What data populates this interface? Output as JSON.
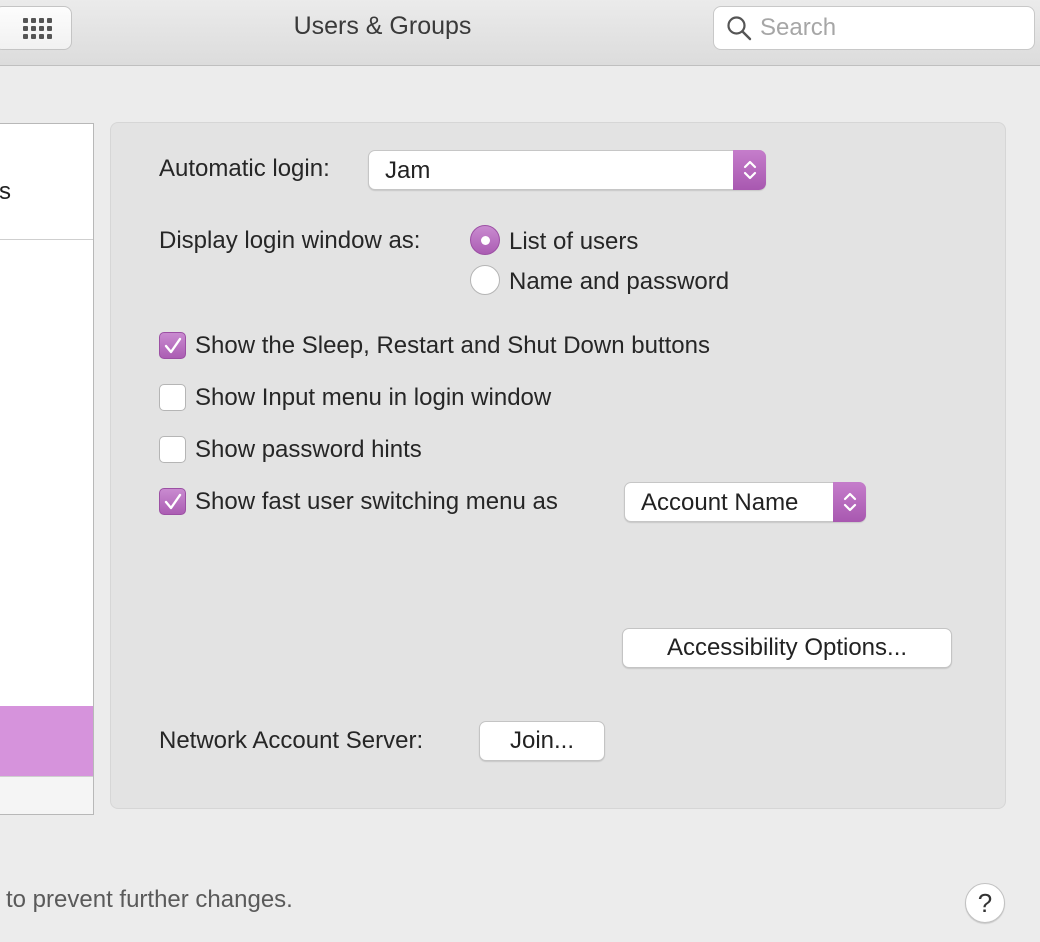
{
  "window": {
    "title": "Users & Groups",
    "search_placeholder": "Search"
  },
  "sidebar": {
    "partial_label": "s"
  },
  "login_options": {
    "automatic_login_label": "Automatic login:",
    "automatic_login_value": "Jam",
    "display_login_label": "Display login window as:",
    "radio_options": [
      {
        "label": "List of users",
        "selected": true
      },
      {
        "label": "Name and password",
        "selected": false
      }
    ],
    "checkboxes": [
      {
        "label": "Show the Sleep, Restart and Shut Down buttons",
        "checked": true
      },
      {
        "label": "Show Input menu in login window",
        "checked": false
      },
      {
        "label": "Show password hints",
        "checked": false
      },
      {
        "label": "Show fast user switching menu as",
        "checked": true
      }
    ],
    "fast_user_switching_value": "Account Name",
    "accessibility_button": "Accessibility Options...",
    "network_account_label": "Network Account Server:",
    "join_button": "Join..."
  },
  "footer": {
    "lock_text": "to prevent further changes.",
    "help_label": "?"
  },
  "colors": {
    "accent": "#b366bb",
    "selection": "#d693dc"
  }
}
